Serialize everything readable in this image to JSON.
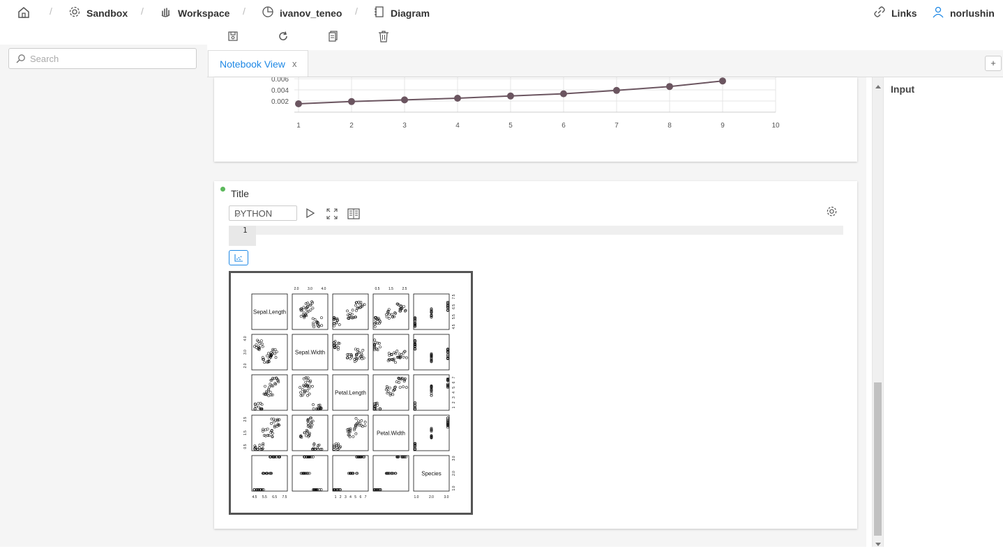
{
  "breadcrumb": {
    "home": "home-icon",
    "items": [
      "Sandbox",
      "Workspace",
      "ivanov_teneo",
      "Diagram"
    ],
    "separator": "/"
  },
  "header_right": {
    "links_label": "Links",
    "user_label": "norlushin"
  },
  "toolbar": {
    "icons": [
      "save-icon",
      "refresh-icon",
      "copy-icon",
      "delete-icon"
    ]
  },
  "search": {
    "placeholder": "Search",
    "value": ""
  },
  "tabs": [
    {
      "label": "Notebook View",
      "close": "x",
      "active": true
    }
  ],
  "add_tab_label": "+",
  "cell1": {
    "chart_data": {
      "type": "line",
      "x": [
        1,
        2,
        3,
        4,
        5,
        6,
        7,
        8,
        9
      ],
      "y": [
        0.0015,
        0.0019,
        0.0022,
        0.0025,
        0.0029,
        0.0033,
        0.0039,
        0.0046,
        0.0056
      ],
      "xlim": [
        1,
        10
      ],
      "x_ticks": [
        "1",
        "2",
        "3",
        "4",
        "5",
        "6",
        "7",
        "8",
        "9",
        "10"
      ],
      "y_ticks": [
        "0.002",
        "0.004",
        "0.006"
      ],
      "grid": true,
      "color": "#6b5560"
    }
  },
  "cell2": {
    "title": "Title",
    "status_color": "#5cb85c",
    "language": "PYTHON",
    "line_number": "1",
    "code": "",
    "pairs_plot": {
      "variables": [
        "Sepal.Length",
        "Sepal.Width",
        "Petal.Length",
        "Petal.Width",
        "Species"
      ],
      "top_axis_labels": [
        [
          "2.0",
          "3.0",
          "4.0"
        ],
        [
          "0.5",
          "1.5",
          "2.5"
        ]
      ],
      "bottom_axis_labels": [
        [
          "4.5",
          "5.5",
          "6.5",
          "7.5"
        ],
        [
          "1",
          "2",
          "3",
          "4",
          "5",
          "6",
          "7"
        ],
        [
          "1.0",
          "2.0",
          "3.0"
        ]
      ],
      "right_axis_labels": [
        [
          "4.5",
          "5.5",
          "6.5",
          "7.5"
        ],
        [
          "1",
          "2",
          "3",
          "4",
          "5",
          "6",
          "7"
        ],
        [
          "1.0",
          "2.0",
          "3.0"
        ]
      ],
      "left_axis_labels": [
        [
          "2.0",
          "3.0",
          "4.0"
        ],
        [
          "0.5",
          "1.5",
          "2.5"
        ]
      ]
    }
  },
  "right_panel": {
    "title": "Input"
  }
}
